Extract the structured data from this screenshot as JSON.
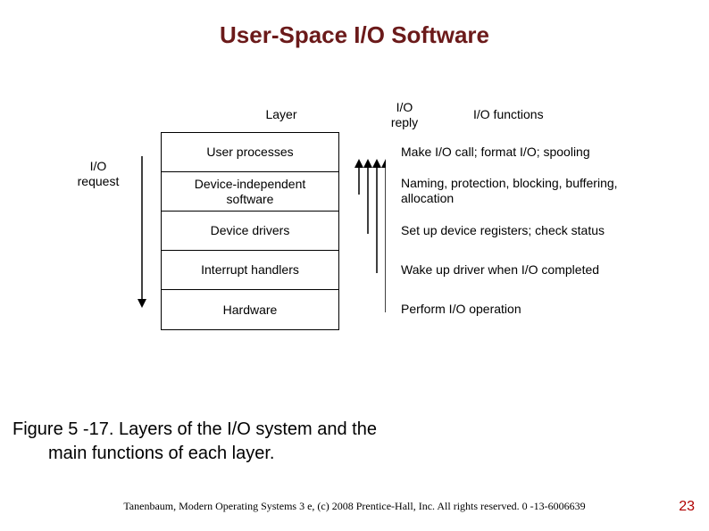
{
  "title": "User-Space I/O Software",
  "headers": {
    "layer": "Layer",
    "reply": "I/O\nreply",
    "functions": "I/O functions",
    "request": "I/O\nrequest"
  },
  "layers": [
    "User processes",
    "Device-independent\nsoftware",
    "Device drivers",
    "Interrupt handlers",
    "Hardware"
  ],
  "functions": [
    "Make I/O call; format I/O; spooling",
    "Naming, protection, blocking, buffering, allocation",
    "Set up device registers; check status",
    "Wake up driver when I/O completed",
    "Perform I/O operation"
  ],
  "caption": {
    "line1": "Figure 5 -17. Layers of the I/O system and the",
    "line2": "main functions of each layer."
  },
  "footer": "Tanenbaum, Modern Operating Systems 3 e, (c) 2008 Prentice-Hall, Inc. All rights reserved. 0 -13-6006639",
  "pagenum": "23"
}
